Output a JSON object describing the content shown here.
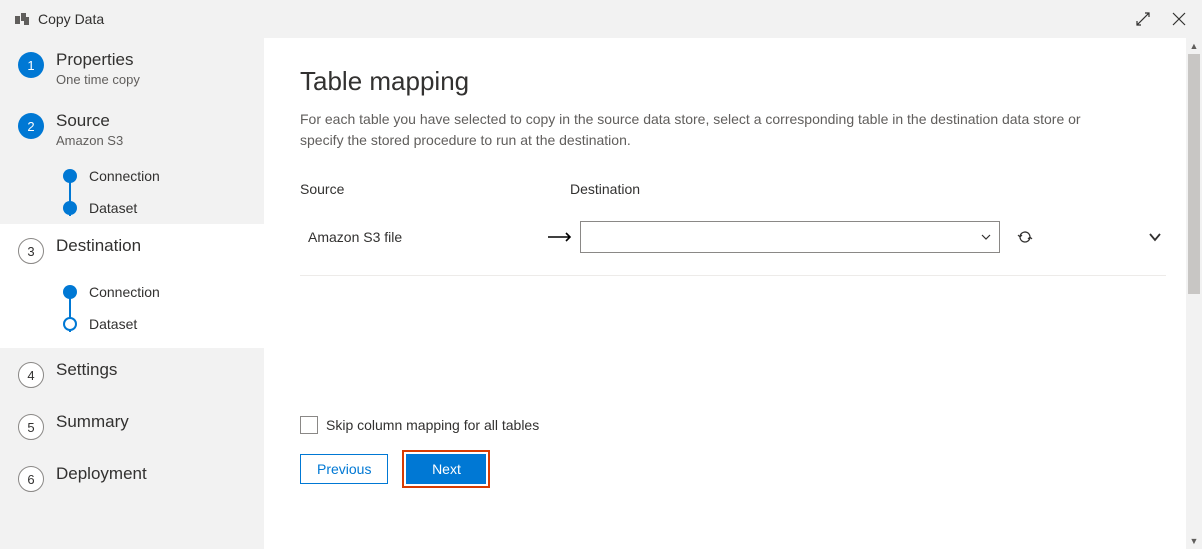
{
  "window": {
    "title": "Copy Data"
  },
  "sidebar": {
    "steps": [
      {
        "num": "1",
        "title": "Properties",
        "sub": "One time copy"
      },
      {
        "num": "2",
        "title": "Source",
        "sub": "Amazon S3",
        "substeps": [
          {
            "label": "Connection"
          },
          {
            "label": "Dataset"
          }
        ]
      },
      {
        "num": "3",
        "title": "Destination",
        "sub": "",
        "substeps": [
          {
            "label": "Connection"
          },
          {
            "label": "Dataset"
          }
        ]
      },
      {
        "num": "4",
        "title": "Settings",
        "sub": ""
      },
      {
        "num": "5",
        "title": "Summary",
        "sub": ""
      },
      {
        "num": "6",
        "title": "Deployment",
        "sub": ""
      }
    ]
  },
  "main": {
    "heading": "Table mapping",
    "description": "For each table you have selected to copy in the source data store, select a corresponding table in the destination data store or specify the stored procedure to run at the destination.",
    "headers": {
      "source": "Source",
      "destination": "Destination"
    },
    "rows": [
      {
        "source": "Amazon S3 file",
        "destination": ""
      }
    ],
    "skipLabel": "Skip column mapping for all tables",
    "buttons": {
      "prev": "Previous",
      "next": "Next"
    }
  }
}
